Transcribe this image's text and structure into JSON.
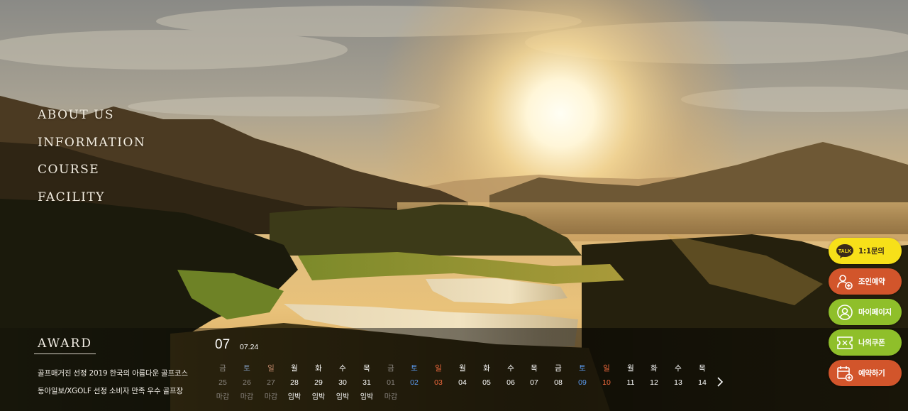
{
  "nav": {
    "items": [
      {
        "label": "ABOUT US"
      },
      {
        "label": "INFORMATION"
      },
      {
        "label": "COURSE"
      },
      {
        "label": "FACILITY"
      }
    ]
  },
  "award": {
    "title": "AWARD",
    "lines": [
      "골프매거진 선정 2019 한국의 아름다운 골프코스",
      "동아일보/XGOLF 선정 소비자 만족 우수 골프장"
    ]
  },
  "calendar": {
    "month": "07",
    "today": "07.24",
    "next_icon": "chevron-right-icon",
    "days": [
      {
        "weekday": "금",
        "date": "25",
        "status": "마감",
        "kind": "past"
      },
      {
        "weekday": "토",
        "date": "26",
        "status": "마감",
        "kind": "past-sat"
      },
      {
        "weekday": "일",
        "date": "27",
        "status": "마감",
        "kind": "past-sun"
      },
      {
        "weekday": "월",
        "date": "28",
        "status": "임박",
        "kind": "normal"
      },
      {
        "weekday": "화",
        "date": "29",
        "status": "임박",
        "kind": "normal"
      },
      {
        "weekday": "수",
        "date": "30",
        "status": "임박",
        "kind": "normal"
      },
      {
        "weekday": "목",
        "date": "31",
        "status": "임박",
        "kind": "normal"
      },
      {
        "weekday": "금",
        "date": "01",
        "status": "마감",
        "kind": "past"
      },
      {
        "weekday": "토",
        "date": "02",
        "status": "",
        "kind": "sat"
      },
      {
        "weekday": "일",
        "date": "03",
        "status": "",
        "kind": "sun"
      },
      {
        "weekday": "월",
        "date": "04",
        "status": "",
        "kind": "normal"
      },
      {
        "weekday": "화",
        "date": "05",
        "status": "",
        "kind": "normal"
      },
      {
        "weekday": "수",
        "date": "06",
        "status": "",
        "kind": "normal"
      },
      {
        "weekday": "목",
        "date": "07",
        "status": "",
        "kind": "normal"
      },
      {
        "weekday": "금",
        "date": "08",
        "status": "",
        "kind": "normal"
      },
      {
        "weekday": "토",
        "date": "09",
        "status": "",
        "kind": "sat"
      },
      {
        "weekday": "일",
        "date": "10",
        "status": "",
        "kind": "sun"
      },
      {
        "weekday": "월",
        "date": "11",
        "status": "",
        "kind": "normal"
      },
      {
        "weekday": "화",
        "date": "12",
        "status": "",
        "kind": "normal"
      },
      {
        "weekday": "수",
        "date": "13",
        "status": "",
        "kind": "normal"
      },
      {
        "weekday": "목",
        "date": "14",
        "status": "",
        "kind": "normal"
      }
    ]
  },
  "quick_menu": [
    {
      "label": "1:1문의",
      "icon": "kakaotalk-icon",
      "icon_text": "TALK",
      "bg": "#f7e019",
      "fg": "#3a2a1a"
    },
    {
      "label": "조인예약",
      "icon": "add-user-icon",
      "bg": "#d2552b",
      "fg": "#ffffff"
    },
    {
      "label": "마이페이지",
      "icon": "user-circle-icon",
      "bg": "#8fbf2a",
      "fg": "#ffffff"
    },
    {
      "label": "나의쿠폰",
      "icon": "coupon-icon",
      "bg": "#8fbf2a",
      "fg": "#ffffff"
    },
    {
      "label": "예약하기",
      "icon": "calendar-add-icon",
      "bg": "#d2552b",
      "fg": "#ffffff"
    }
  ],
  "colors": {
    "saturday": "#5b9bf0",
    "sunday": "#f26a3d",
    "kakao_yellow": "#f7e019",
    "orange": "#d2552b",
    "green": "#8fbf2a"
  }
}
